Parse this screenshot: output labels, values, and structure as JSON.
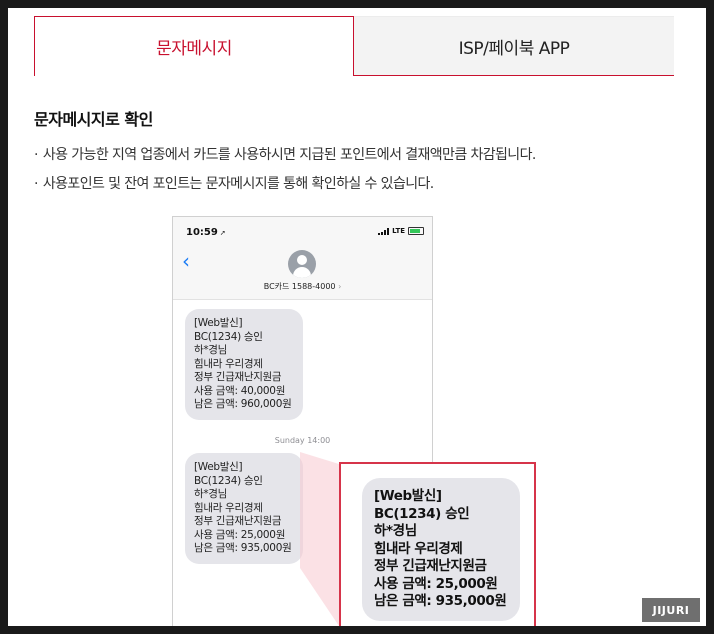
{
  "tabs": [
    {
      "label": "문자메시지",
      "active": true
    },
    {
      "label": "ISP/페이북 APP",
      "active": false
    }
  ],
  "section": {
    "title": "문자메시지로 확인",
    "bullets": [
      "사용 가능한 지역 업종에서 카드를 사용하시면 지급된 포인트에서 결재액만큼 차감됩니다.",
      "사용포인트 및 잔여 포인트는 문자메시지를 통해 확인하실 수 있습니다."
    ]
  },
  "phone": {
    "time": "10:59",
    "network": "LTE",
    "contact": "BC카드 1588-4000",
    "timestamp": "Sunday 14:00",
    "messages": [
      {
        "lines": [
          "[Web발신]",
          "BC(1234) 승인",
          "하*경님",
          "힘내라 우리경제",
          "정부 긴급재난지원금",
          "사용 금액: 40,000원",
          "남은 금액: 960,000원"
        ]
      },
      {
        "lines": [
          "[Web발신]",
          "BC(1234) 승인",
          "하*경님",
          "힘내라 우리경제",
          "정부 긴급재난지원금",
          "사용 금액: 25,000원",
          "남은 금액: 935,000원"
        ]
      }
    ]
  },
  "zoom": {
    "lines": [
      "[Web발신]",
      "BC(1234) 승인",
      "하*경님",
      "힘내라 우리경제",
      "정부 긴급재난지원금",
      "사용 금액: 25,000원",
      "남은 금액: 935,000원"
    ]
  },
  "watermark": "JIJURI",
  "colors": {
    "accent": "#c8102e",
    "bubble": "#e5e5ea",
    "ios_blue": "#1a7cf5"
  },
  "icons": [
    "back-chevron-icon",
    "contact-avatar-icon",
    "signal-icon",
    "battery-icon",
    "location-arrow-icon"
  ]
}
